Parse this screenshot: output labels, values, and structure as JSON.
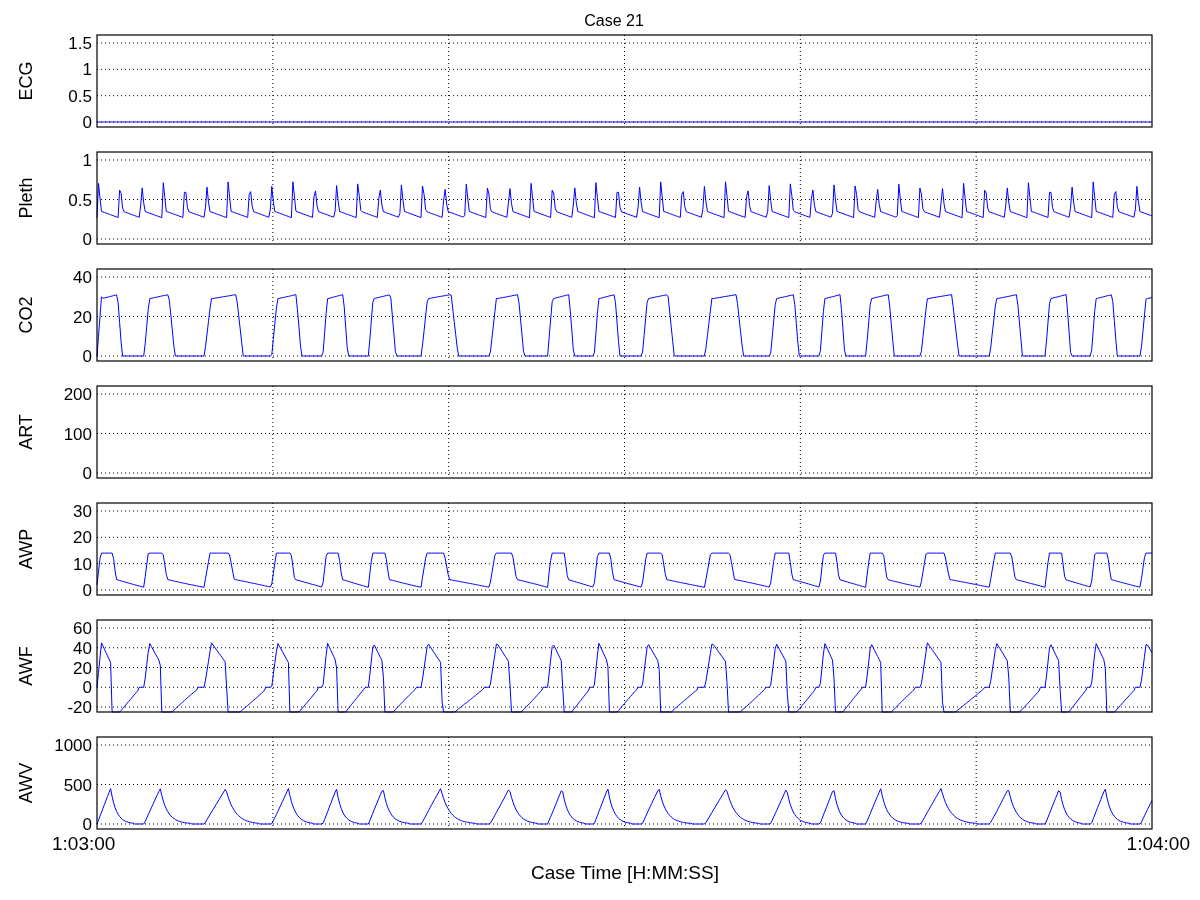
{
  "figure": {
    "title": "Case 21"
  },
  "panels": [
    {
      "ylabel": "ECG",
      "kind": "flat",
      "yticks": [
        "1.5",
        "1",
        "0.5",
        "0"
      ]
    },
    {
      "ylabel": "Pleth",
      "kind": "pleth",
      "yticks": [
        "1",
        "0.5",
        "0"
      ]
    },
    {
      "ylabel": "CO2",
      "kind": "co2",
      "yticks": [
        "40",
        "20",
        "0"
      ]
    },
    {
      "ylabel": "ART",
      "kind": "none",
      "yticks": [
        "200",
        "100",
        "0"
      ]
    },
    {
      "ylabel": "AWP",
      "kind": "awp",
      "yticks": [
        "30",
        "20",
        "10",
        "0"
      ]
    },
    {
      "ylabel": "AWF",
      "kind": "awf",
      "yticks": [
        "60",
        "40",
        "20",
        "0",
        "-20"
      ]
    },
    {
      "ylabel": "AWV",
      "kind": "awv",
      "yticks": [
        "1000",
        "500",
        "0"
      ]
    }
  ],
  "x_axis": {
    "start_label": "1:03:00",
    "end_label": "1:04:00",
    "title": "Case Time [H:MM:SS]"
  }
}
